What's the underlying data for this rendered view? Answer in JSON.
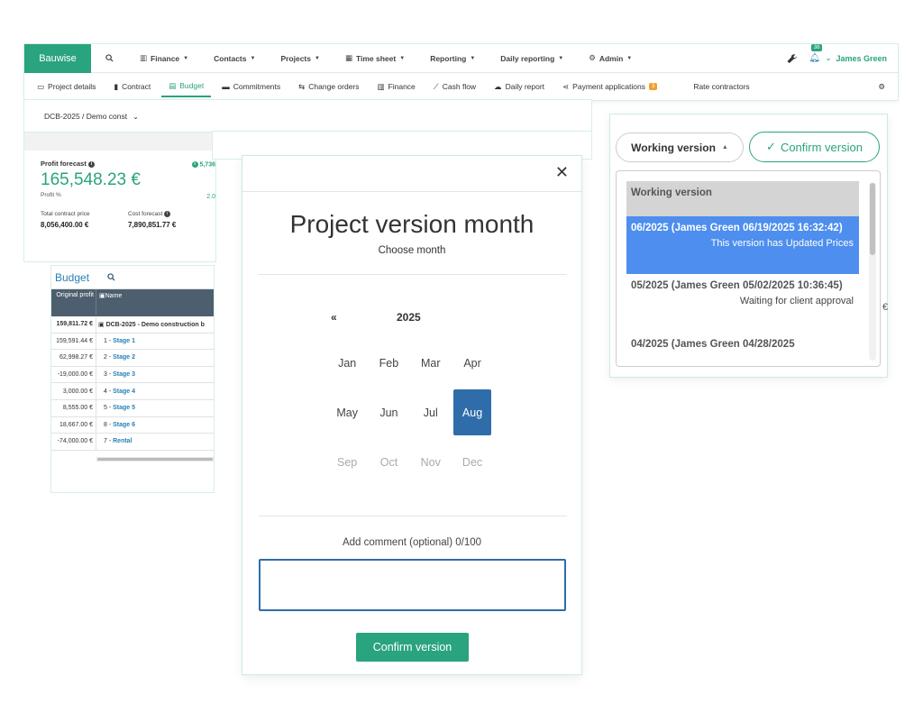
{
  "app": {
    "brand": "Bauwise",
    "menus": [
      {
        "label": "Finance",
        "icon": "finance-icon"
      },
      {
        "label": "Contacts",
        "icon": ""
      },
      {
        "label": "Projects",
        "icon": ""
      },
      {
        "label": "Time sheet",
        "icon": "calendar-icon"
      },
      {
        "label": "Reporting",
        "icon": ""
      },
      {
        "label": "Daily reporting",
        "icon": ""
      },
      {
        "label": "Admin",
        "icon": "gear-icon"
      }
    ],
    "notification_count": "38",
    "user_name": "James Green"
  },
  "tabs": {
    "project_details": "Project details",
    "contract": "Contract",
    "budget": "Budget",
    "commitments": "Commitments",
    "change_orders": "Change orders",
    "finance": "Finance",
    "cash_flow": "Cash flow",
    "daily_report": "Daily report",
    "payment_applications": "Payment applications",
    "payment_applications_badge": "3",
    "rate_contractors": "Rate contractors"
  },
  "project_selector": "DCB-2025 / Demo const",
  "profit": {
    "label": "Profit forecast",
    "value": "165,548.23 €",
    "percent_label": "Profit %",
    "right_top": "5,736",
    "right_mid": "2.0",
    "contract_label": "Total contract price",
    "contract_value": "8,056,400.00 €",
    "cost_label": "Cost forecast",
    "cost_value": "7,890,851.77 €"
  },
  "budget": {
    "title": "Budget",
    "col_original_profit": "Original profit",
    "col_name": "Name",
    "rows": [
      {
        "profit": "159,811.72 €",
        "name": "DCB-2025 - Demo construction b",
        "prefix": ""
      },
      {
        "profit": "159,591.44 €",
        "prefix": "1 - ",
        "name": "Stage 1"
      },
      {
        "profit": "62,998.27 €",
        "prefix": "2 - ",
        "name": "Stage 2"
      },
      {
        "profit": "-19,000.00 €",
        "prefix": "3 - ",
        "name": "Stage 3"
      },
      {
        "profit": "3,000.00 €",
        "prefix": "4 - ",
        "name": "Stage 4"
      },
      {
        "profit": "8,555.00 €",
        "prefix": "5 - ",
        "name": "Stage 5"
      },
      {
        "profit": "18,667.00 €",
        "prefix": "8 - ",
        "name": "Stage 6"
      },
      {
        "profit": "-74,000.00 €",
        "prefix": "7 - ",
        "name": "Rental"
      }
    ]
  },
  "modal": {
    "title": "Project version month",
    "subtitle": "Choose month",
    "prev_label": "«",
    "year": "2025",
    "months": [
      "Jan",
      "Feb",
      "Mar",
      "Apr",
      "May",
      "Jun",
      "Jul",
      "Aug",
      "Sep",
      "Oct",
      "Nov",
      "Dec"
    ],
    "selected_month": "Aug",
    "comment_label": "Add comment (optional) 0/100",
    "comment_value": "",
    "confirm_label": "Confirm version"
  },
  "version_panel": {
    "working_version_label": "Working version",
    "confirm_label": "Confirm version",
    "group_label": "Working version",
    "items": [
      {
        "title": "06/2025 (James Green 06/19/2025 16:32:42)",
        "note": "This version has Updated Prices"
      },
      {
        "title": "05/2025 (James Green 05/02/2025 10:36:45)",
        "note": "Waiting for client approval"
      },
      {
        "title": "04/2025 (James Green 04/28/2025",
        "note": ""
      }
    ]
  },
  "colors": {
    "brand": "#2aa37f",
    "selected_month": "#2e6daa",
    "active_item": "#4d8eee"
  }
}
